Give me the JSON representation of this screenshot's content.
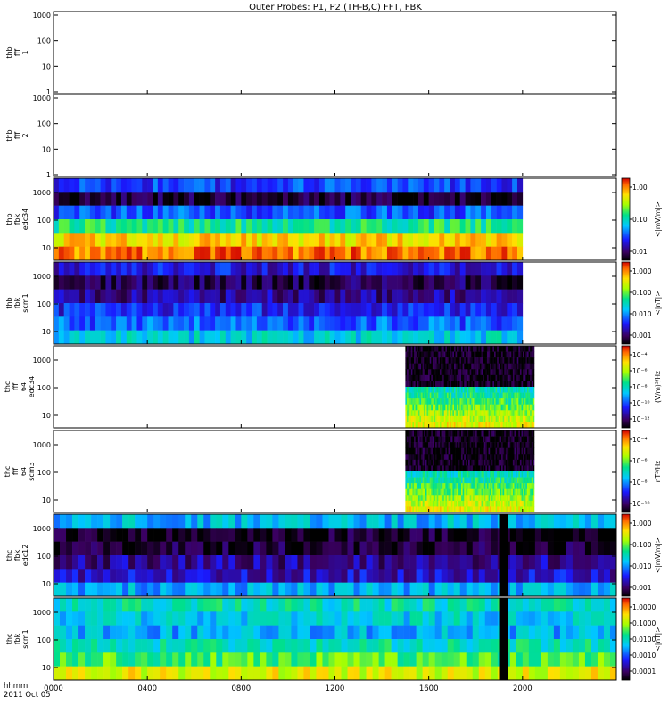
{
  "title": "Outer Probes: P1, P2 (TH-B,C) FFT, FBK",
  "x_axis": {
    "units_label": "hhmm",
    "date_label": "2011 Oct 05",
    "ticks": [
      "0000",
      "0400",
      "0800",
      "1200",
      "1600",
      "2000"
    ]
  },
  "chart_data": [
    {
      "type": "heatmap",
      "ylabel": [
        "thb",
        "fff",
        "1"
      ],
      "yscale": "log",
      "ylim": [
        1,
        1000
      ],
      "ytick_labels": [
        "1",
        "10",
        "100",
        "1000"
      ],
      "data_range": null,
      "colorbar": null
    },
    {
      "type": "heatmap",
      "ylabel": [
        "thb",
        "fff",
        "2"
      ],
      "yscale": "log",
      "ylim": [
        1,
        1000
      ],
      "ytick_labels": [
        "1",
        "10",
        "100",
        "1000"
      ],
      "data_range": null,
      "colorbar": null
    },
    {
      "type": "heatmap",
      "ylabel": [
        "thb",
        "fbk",
        "edc34"
      ],
      "yscale": "log",
      "ytick_labels": [
        "10",
        "100",
        "1000"
      ],
      "data_range": [
        "0000",
        "2000"
      ],
      "colorbar": {
        "label": "<|mV/m|>",
        "ticks": [
          "1.00",
          "0.10",
          "0.01"
        ]
      }
    },
    {
      "type": "heatmap",
      "ylabel": [
        "thb",
        "fbk",
        "scm1"
      ],
      "yscale": "log",
      "ytick_labels": [
        "10",
        "100",
        "1000"
      ],
      "data_range": [
        "0000",
        "2000"
      ],
      "colorbar": {
        "label": "<|nT|>",
        "ticks": [
          "1.000",
          "0.100",
          "0.010",
          "0.001"
        ]
      }
    },
    {
      "type": "heatmap",
      "ylabel": [
        "thc",
        "fff",
        "64",
        "edc34"
      ],
      "yscale": "log",
      "ytick_labels": [
        "10",
        "100",
        "1000"
      ],
      "data_range": [
        "1500",
        "2030"
      ],
      "colorbar": {
        "label": "(V/m)²/Hz",
        "ticks": [
          "10⁻⁴",
          "10⁻⁶",
          "10⁻⁸",
          "10⁻¹⁰",
          "10⁻¹²"
        ]
      }
    },
    {
      "type": "heatmap",
      "ylabel": [
        "thc",
        "fff",
        "64",
        "scm3"
      ],
      "yscale": "log",
      "ytick_labels": [
        "10",
        "100",
        "1000"
      ],
      "data_range": [
        "1500",
        "2030"
      ],
      "colorbar": {
        "label": "nT²/Hz",
        "ticks": [
          "10⁻⁴",
          "10⁻⁶",
          "10⁻⁸",
          "10⁻¹⁰"
        ]
      }
    },
    {
      "type": "heatmap",
      "ylabel": [
        "thc",
        "fbk",
        "edc12"
      ],
      "yscale": "log",
      "ytick_labels": [
        "10",
        "100",
        "1000"
      ],
      "data_range": [
        "0000",
        "2400"
      ],
      "colorbar": {
        "label": "<|mV/m|>",
        "ticks": [
          "1.000",
          "0.100",
          "0.010",
          "0.001"
        ]
      }
    },
    {
      "type": "heatmap",
      "ylabel": [
        "thc",
        "fbk",
        "scm1"
      ],
      "yscale": "log",
      "ytick_labels": [
        "10",
        "100",
        "1000"
      ],
      "data_range": [
        "0000",
        "2400"
      ],
      "colorbar": {
        "label": "<|nT|>",
        "ticks": [
          "1.0000",
          "0.1000",
          "0.0100",
          "0.0010",
          "0.0001"
        ]
      }
    }
  ]
}
